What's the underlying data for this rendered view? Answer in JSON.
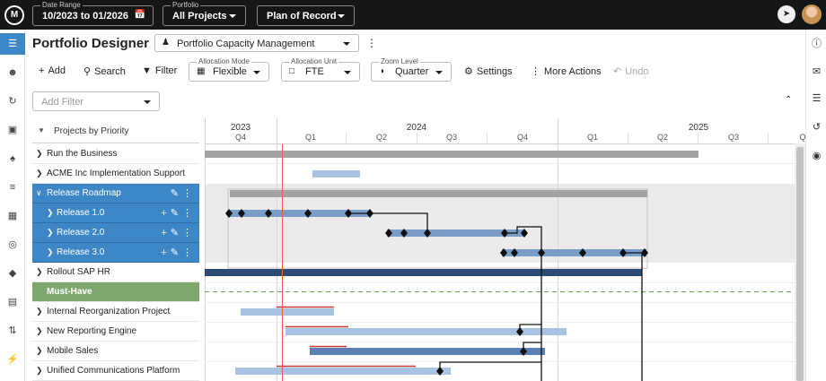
{
  "topbar": {
    "logo": "M",
    "date_range_label": "Date Range",
    "date_range_value": "10/2023 to 01/2026",
    "portfolio_label": "Portfolio",
    "portfolio_value": "All Projects",
    "plan_value": "Plan of Record"
  },
  "left_nav": {
    "icons": [
      "menu-icon",
      "people-icon",
      "refresh-icon",
      "clipboard-icon",
      "group-icon",
      "list-icon",
      "columns-icon",
      "target-icon",
      "diamond-icon",
      "document-icon",
      "sort-icon",
      "plug-icon"
    ]
  },
  "right_nav": {
    "icons": [
      "info-icon",
      "chat-icon",
      "comment-icon",
      "history-icon",
      "palette-icon"
    ]
  },
  "title": {
    "page_title": "Portfolio Designer",
    "view_name": "Portfolio Capacity Management"
  },
  "toolbar": {
    "add": "Add",
    "search": "Search",
    "filter": "Filter",
    "allocation_mode_label": "Allocation Mode",
    "allocation_mode_value": "Flexible",
    "allocation_unit_label": "Allocation Unit",
    "allocation_unit_value": "FTE",
    "zoom_label": "Zoom Level",
    "zoom_value": "Quarter",
    "settings": "Settings",
    "more_actions": "More Actions",
    "undo": "Undo"
  },
  "filter": {
    "placeholder": "Add Filter"
  },
  "grid": {
    "header": "Projects by Priority",
    "rows": [
      {
        "label": "Run the Business",
        "kind": "row"
      },
      {
        "label": "ACME Inc Implementation Support",
        "kind": "row"
      },
      {
        "label": "Release Roadmap",
        "kind": "selected"
      },
      {
        "label": "Release 1.0",
        "kind": "selected-sub"
      },
      {
        "label": "Release 2.0",
        "kind": "selected-sub"
      },
      {
        "label": "Release 3.0",
        "kind": "selected-sub"
      },
      {
        "label": "Rollout SAP HR",
        "kind": "row"
      },
      {
        "label": "Must-Have",
        "kind": "group"
      },
      {
        "label": "Internal Reorganization Project",
        "kind": "row"
      },
      {
        "label": "New Reporting Engine",
        "kind": "row"
      },
      {
        "label": "Mobile Sales",
        "kind": "row"
      },
      {
        "label": "Unified Communications Platform",
        "kind": "row"
      }
    ]
  },
  "timeline": {
    "years": [
      "2023",
      "2024",
      "2025"
    ],
    "quarters": [
      "Q4",
      "Q1",
      "Q2",
      "Q3",
      "Q4",
      "Q1",
      "Q2",
      "Q3",
      "Q"
    ],
    "colors": {
      "summary": "#a3a3a3",
      "bar": "#7a9cc8",
      "light_bar": "#a8c2e2",
      "dark_bar": "#2b4c74",
      "mid_bar": "#5d80b4",
      "today": "#e8604c",
      "overrun": "#c0392b",
      "must_have_line": "#6aa355",
      "band": "#ebebeb"
    }
  }
}
